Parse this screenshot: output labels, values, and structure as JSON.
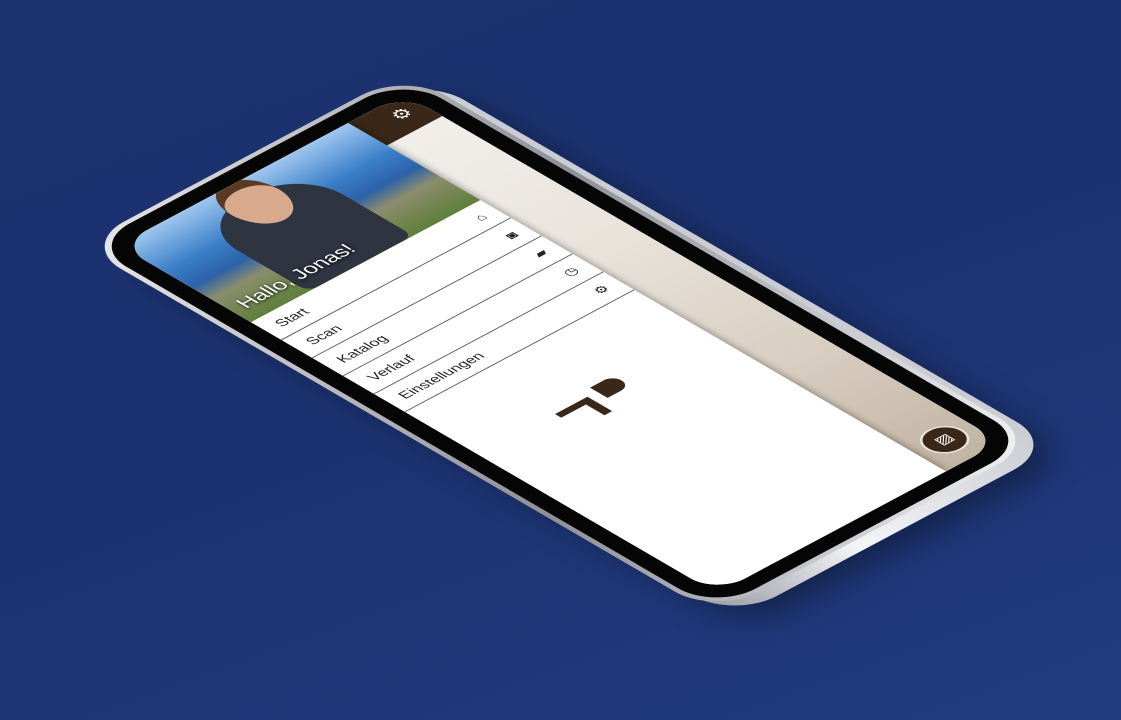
{
  "appbar": {
    "settings_icon": "gear-icon"
  },
  "drawer": {
    "greeting": "Hallo, Jonas!",
    "items": [
      {
        "label": "Start",
        "icon": "home-icon",
        "glyph": "⌂"
      },
      {
        "label": "Scan",
        "icon": "camera-icon",
        "glyph": "◙"
      },
      {
        "label": "Katalog",
        "icon": "shopping-bag-icon",
        "glyph": "▰"
      },
      {
        "label": "Verlauf",
        "icon": "clock-icon",
        "glyph": "◷"
      },
      {
        "label": "Einstellungen",
        "icon": "gear-icon",
        "glyph": "⚙"
      }
    ]
  },
  "camera": {
    "gallery_icon": "gallery-icon"
  },
  "colors": {
    "brand": "#3a2718",
    "background": "#1d3370"
  }
}
